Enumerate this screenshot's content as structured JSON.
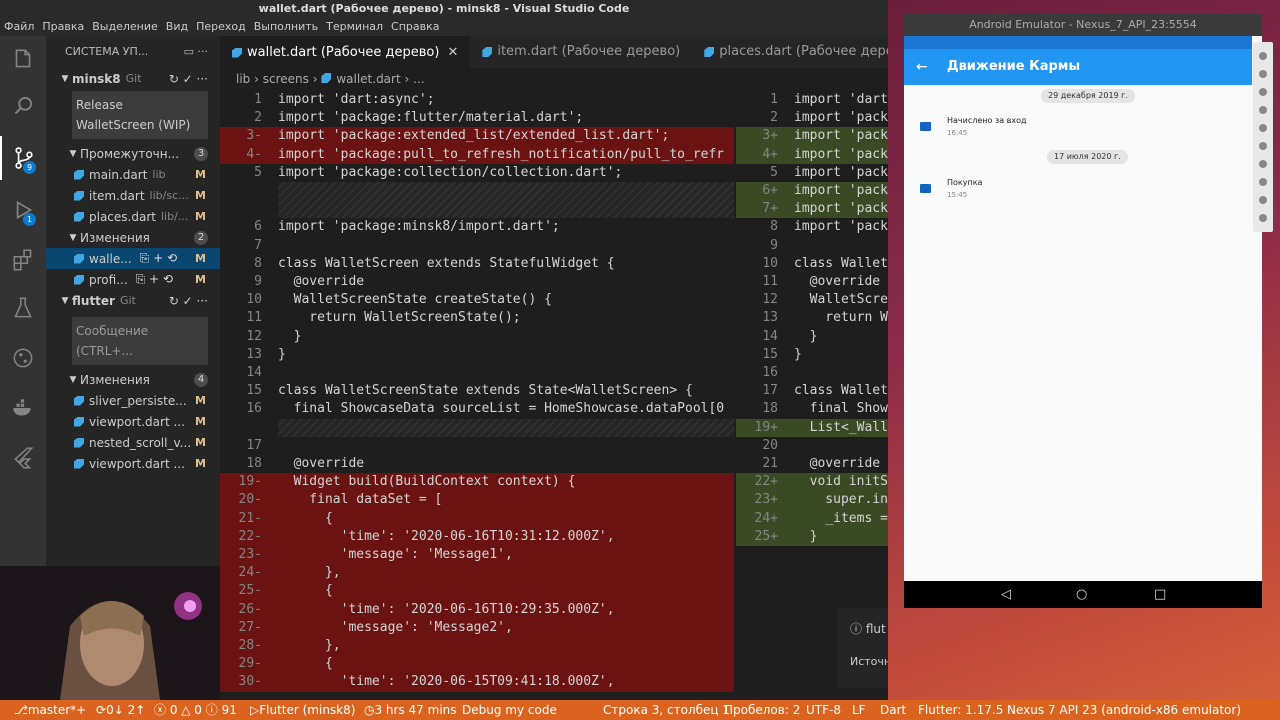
{
  "window": {
    "title": "wallet.dart (Рабочее дерево) - minsk8 - Visual Studio Code"
  },
  "menu": [
    "Файл",
    "Правка",
    "Выделение",
    "Вид",
    "Переход",
    "Выполнить",
    "Терминал",
    "Справка"
  ],
  "activity": {
    "scm_badge": "9",
    "debug_badge": "1"
  },
  "sidebar": {
    "header": "СИСТЕМА УП...",
    "repo1": {
      "name": "minsk8",
      "provider": "Git"
    },
    "commit_message": "Release WalletScreen (WIP)",
    "staged": {
      "label": "Промежуточн...",
      "count": "3",
      "files": [
        {
          "name": "main.dart",
          "path": "lib",
          "status": "M"
        },
        {
          "name": "item.dart",
          "path": "lib/sc...",
          "status": "M"
        },
        {
          "name": "places.dart",
          "path": "lib/...",
          "status": "M"
        }
      ]
    },
    "changes": {
      "label": "Изменения",
      "count": "2",
      "files": [
        {
          "name": "walle...",
          "status": "M"
        },
        {
          "name": "profi...",
          "status": "M"
        }
      ]
    },
    "repo2": {
      "name": "flutter",
      "provider": "Git"
    },
    "message_placeholder": "Сообщение (CTRL+...",
    "changes2": {
      "label": "Изменения",
      "count": "4",
      "files": [
        {
          "name": "sliver_persiste...",
          "status": "M"
        },
        {
          "name": "viewport.dart ...",
          "status": "M"
        },
        {
          "name": "nested_scroll_v...",
          "status": "M"
        },
        {
          "name": "viewport.dart ...",
          "status": "M"
        }
      ]
    }
  },
  "tabs": [
    {
      "label": "wallet.dart (Рабочее дерево)",
      "active": true
    },
    {
      "label": "item.dart (Рабочее дерево)"
    },
    {
      "label": "places.dart (Рабочее дерево)"
    }
  ],
  "breadcrumb": {
    "p1": "lib",
    "p2": "screens",
    "p3": "wallet.dart",
    "p4": "..."
  },
  "left_lines": [
    {
      "n": "1",
      "code": "import 'dart:async';"
    },
    {
      "n": "2",
      "code": "import 'package:flutter/material.dart';"
    },
    {
      "n": "3-",
      "code": "import 'package:extended_list/extended_list.dart';"
    },
    {
      "n": "4-",
      "code": "import 'package:pull_to_refresh_notification/pull_to_refr"
    },
    {
      "n": "5",
      "code": "import 'package:collection/collection.dart';"
    },
    {
      "n": "6",
      "code": "import 'package:minsk8/import.dart';"
    },
    {
      "n": "7",
      "code": ""
    },
    {
      "n": "8",
      "code": "class WalletScreen extends StatefulWidget {"
    },
    {
      "n": "9",
      "code": "  @override"
    },
    {
      "n": "10",
      "code": "  WalletScreenState createState() {"
    },
    {
      "n": "11",
      "code": "    return WalletScreenState();"
    },
    {
      "n": "12",
      "code": "  }"
    },
    {
      "n": "13",
      "code": "}"
    },
    {
      "n": "14",
      "code": ""
    },
    {
      "n": "15",
      "code": "class WalletScreenState extends State<WalletScreen> {"
    },
    {
      "n": "16",
      "code": "  final ShowcaseData sourceList = HomeShowcase.dataPool[0"
    },
    {
      "n": "17",
      "code": ""
    },
    {
      "n": "18",
      "code": "  @override"
    },
    {
      "n": "19-",
      "code": "  Widget build(BuildContext context) {"
    },
    {
      "n": "20-",
      "code": "    final dataSet = ["
    },
    {
      "n": "21-",
      "code": "      {"
    },
    {
      "n": "22-",
      "code": "        'time': '2020-06-16T10:31:12.000Z',"
    },
    {
      "n": "23-",
      "code": "        'message': 'Message1',"
    },
    {
      "n": "24-",
      "code": "      },"
    },
    {
      "n": "25-",
      "code": "      {"
    },
    {
      "n": "26-",
      "code": "        'time': '2020-06-16T10:29:35.000Z',"
    },
    {
      "n": "27-",
      "code": "        'message': 'Message2',"
    },
    {
      "n": "28-",
      "code": "      },"
    },
    {
      "n": "29-",
      "code": "      {"
    },
    {
      "n": "30-",
      "code": "        'time': '2020-06-15T09:41:18.000Z',"
    }
  ],
  "right_lines": [
    {
      "n": "1",
      "code": "import 'dart"
    },
    {
      "n": "2",
      "code": "import 'pack"
    },
    {
      "n": "3+",
      "code": "import 'pack"
    },
    {
      "n": "4+",
      "code": "import 'pack"
    },
    {
      "n": "5",
      "code": "import 'pack"
    },
    {
      "n": "6+",
      "code": "import 'pack"
    },
    {
      "n": "7+",
      "code": "import 'pack"
    },
    {
      "n": "8",
      "code": "import 'pack"
    },
    {
      "n": "9",
      "code": ""
    },
    {
      "n": "10",
      "code": "class Wallet"
    },
    {
      "n": "11",
      "code": "  @override"
    },
    {
      "n": "12",
      "code": "  WalletScre"
    },
    {
      "n": "13",
      "code": "    return W"
    },
    {
      "n": "14",
      "code": "  }"
    },
    {
      "n": "15",
      "code": "}"
    },
    {
      "n": "16",
      "code": ""
    },
    {
      "n": "17",
      "code": "class Wallet"
    },
    {
      "n": "18",
      "code": "  final Show"
    },
    {
      "n": "19+",
      "code": "  List<_Wall"
    },
    {
      "n": "20",
      "code": ""
    },
    {
      "n": "21",
      "code": "  @override"
    },
    {
      "n": "22+",
      "code": "  void initS"
    },
    {
      "n": "23+",
      "code": "    super.in"
    },
    {
      "n": "24+",
      "code": "    _items ="
    },
    {
      "n": "25+",
      "code": "  }"
    }
  ],
  "notification": {
    "title": "flut",
    "source": "Источн"
  },
  "status": {
    "branch": "master*+",
    "sync": "0↓ 2↑",
    "problems": "ⓧ 0 △ 0 ⓘ 91",
    "launch": "Flutter (minsk8)",
    "time": "3 hrs 47 mins",
    "debug": "Debug my code",
    "position": "Строка 3, столбец 1",
    "spaces": "Пробелов: 2",
    "encoding": "UTF-8",
    "eol": "LF",
    "language": "Dart",
    "flutter": "Flutter: 1.17.5",
    "device": "Nexus 7 API 23 (android-x86 emulator)"
  },
  "emulator": {
    "title": "Android Emulator - Nexus_7_API_23:5554",
    "app_title": "Движение Кармы",
    "entries": [
      {
        "date": "29 декабря 2019 г.",
        "title": "Начислено за вход",
        "time": "16:45"
      },
      {
        "date": "17 июля 2020 г.",
        "title": "Покупка",
        "time": "15:45"
      }
    ]
  }
}
